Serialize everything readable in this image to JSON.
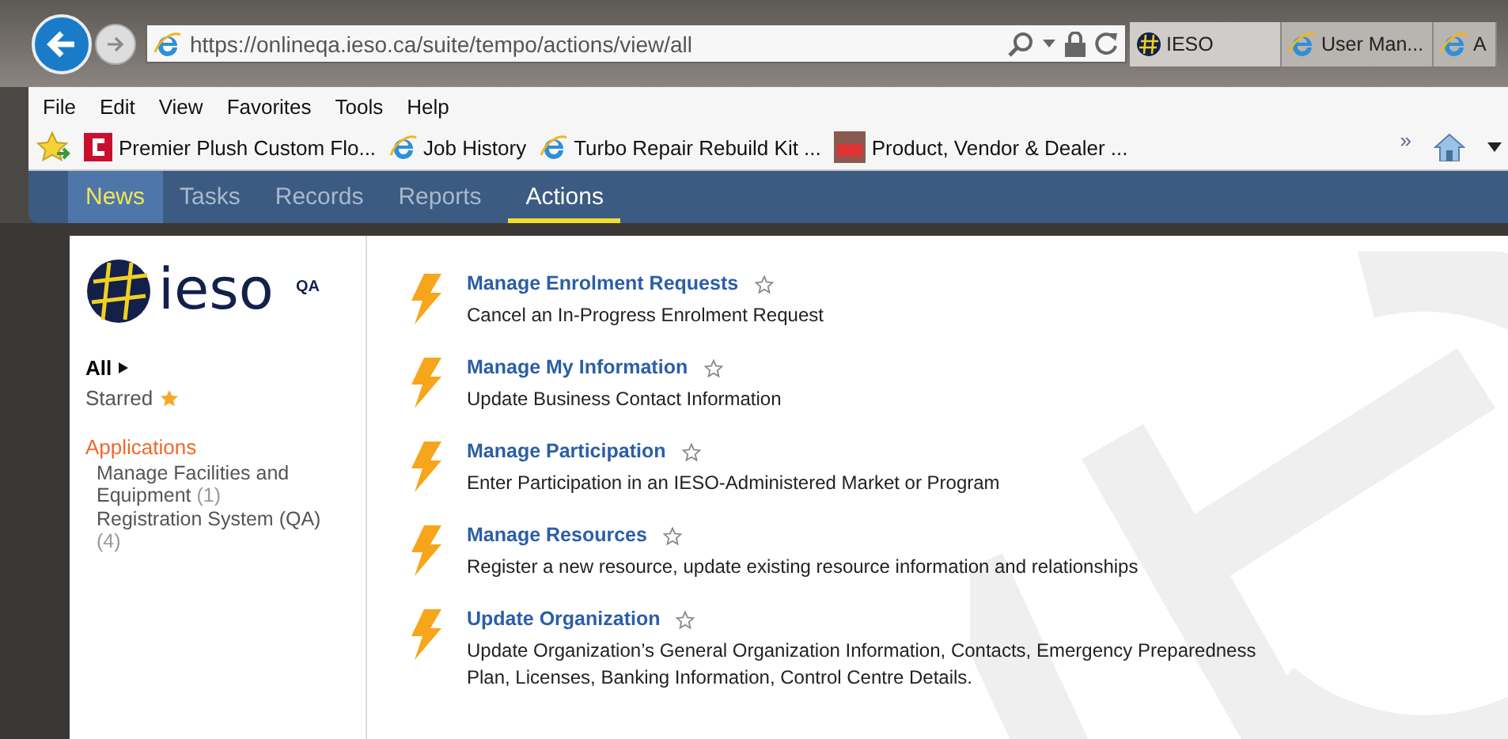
{
  "browser": {
    "address": "https://onlineqa.ieso.ca/suite/tempo/actions/view/all",
    "tabs": [
      {
        "title": "IESO",
        "kind": "site",
        "selected": true
      },
      {
        "title": "User Man...",
        "kind": "ie",
        "selected": false
      },
      {
        "title": "A",
        "kind": "ie",
        "selected": false
      }
    ],
    "menu": [
      "File",
      "Edit",
      "View",
      "Favorites",
      "Tools",
      "Help"
    ],
    "favorites": [
      {
        "label": "Premier Plush Custom Flo...",
        "kind": "brand"
      },
      {
        "label": "Job History",
        "kind": "ie"
      },
      {
        "label": "Turbo Repair Rebuild Kit ...",
        "kind": "ie"
      },
      {
        "label": "Product, Vendor & Dealer ...",
        "kind": "photo"
      }
    ],
    "overflow": "»"
  },
  "nav": [
    {
      "label": "News",
      "hovered": true,
      "selected": false
    },
    {
      "label": "Tasks",
      "hovered": false,
      "selected": false
    },
    {
      "label": "Records",
      "hovered": false,
      "selected": false
    },
    {
      "label": "Reports",
      "hovered": false,
      "selected": false
    },
    {
      "label": "Actions",
      "hovered": false,
      "selected": true
    }
  ],
  "sidebar": {
    "logo": "ieso",
    "badge": "QA",
    "filters": [
      {
        "label": "All",
        "kind": "all",
        "selected": true
      },
      {
        "label": "Starred",
        "kind": "starred",
        "selected": false
      }
    ],
    "heading": "Applications",
    "apps": [
      {
        "name": "Manage Facilities and Equipment",
        "count": "(1)"
      },
      {
        "name": "Registration System (QA)",
        "count": "(4)"
      }
    ]
  },
  "actions": [
    {
      "title": "Manage Enrolment Requests",
      "description": "Cancel an In-Progress Enrolment Request",
      "starred": false
    },
    {
      "title": "Manage My Information",
      "description": "Update Business Contact Information",
      "starred": false
    },
    {
      "title": "Manage Participation",
      "description": "Enter Participation in an IESO-Administered Market or Program",
      "starred": false
    },
    {
      "title": "Manage Resources",
      "description": "Register a new resource, update existing resource information and relationships",
      "starred": false
    },
    {
      "title": "Update Organization",
      "description": "Update Organization’s General Organization Information, Contacts, Emergency Preparedness Plan, Licenses, Banking Information, Control Centre Details.",
      "starred": false
    }
  ]
}
